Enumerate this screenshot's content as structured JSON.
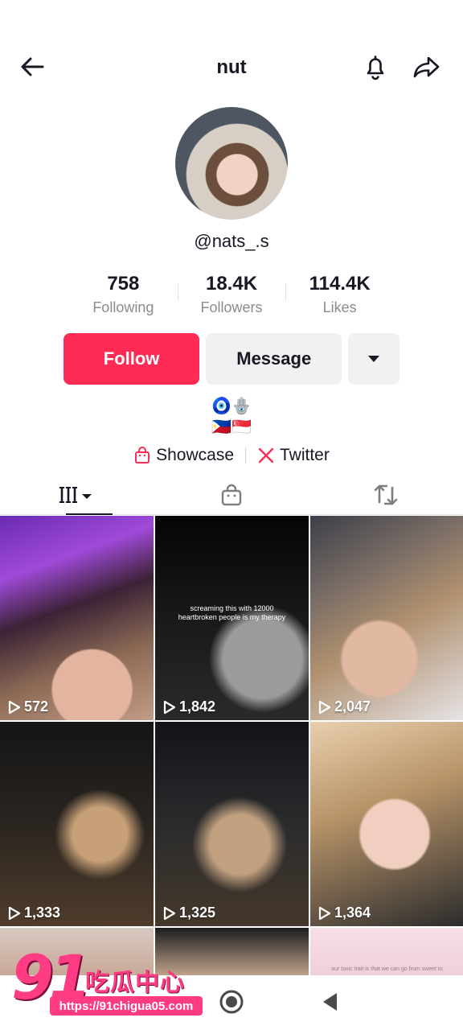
{
  "header": {
    "title": "nut"
  },
  "profile": {
    "handle": "@nats_.s",
    "stats": [
      {
        "value": "758",
        "label": "Following"
      },
      {
        "value": "18.4K",
        "label": "Followers"
      },
      {
        "value": "114.4K",
        "label": "Likes"
      }
    ],
    "follow_label": "Follow",
    "message_label": "Message",
    "bio_line1": "🧿🪬",
    "bio_line2": "🇵🇭🇸🇬",
    "links": {
      "showcase": "Showcase",
      "twitter": "Twitter"
    }
  },
  "tabs": [
    "videos-icon",
    "showcase-bag-icon",
    "reposts-icon"
  ],
  "videos": [
    {
      "views": "572"
    },
    {
      "views": "1,842",
      "caption": "screaming this with 12000 heartbroken people is my therapy"
    },
    {
      "views": "2,047"
    },
    {
      "views": "1,333"
    },
    {
      "views": "1,325"
    },
    {
      "views": "1,364"
    },
    {
      "views": ""
    },
    {
      "views": ""
    },
    {
      "views": "",
      "caption": "our toxic trait is that we can go from sweet to"
    }
  ],
  "watermark": {
    "number": "91",
    "text": "吃瓜中心",
    "url": "https://91chigua05.com"
  },
  "colors": {
    "accent": "#fe2c55",
    "text": "#161823",
    "muted": "#8a8b91"
  }
}
